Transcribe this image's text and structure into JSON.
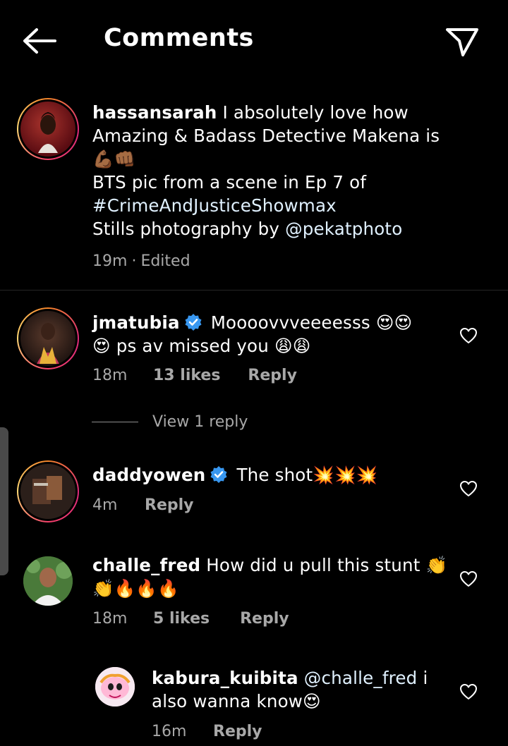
{
  "header": {
    "title": "Comments",
    "back_icon": "arrow-left-icon",
    "share_icon": "send-icon"
  },
  "caption": {
    "username": "hassansarah",
    "text_line1": "I absolutely love how",
    "text_line2": "Amazing & Badass Detective Makena is",
    "text_line3": "💪🏾👊🏾",
    "text_line4": "BTS pic from a scene in Ep 7 of",
    "hashtag": "#CrimeAndJusticeShowmax",
    "text_line6_prefix": "Stills photography by",
    "mention": "@pekatphoto",
    "time": "19m",
    "separator": "·",
    "edited": "Edited"
  },
  "comments": [
    {
      "username": "jmatubia",
      "verified": true,
      "text_line1": "Moooovvveeeesss 😍😍",
      "text_line2": "😍 ps av missed you 😩😩",
      "time": "18m",
      "likes": "13 likes",
      "reply": "Reply",
      "view_replies": "View 1 reply"
    },
    {
      "username": "daddyowen",
      "verified": true,
      "text_line1": "The shot💥💥💥",
      "time": "4m",
      "reply": "Reply"
    },
    {
      "username": "challe_fred",
      "verified": false,
      "text_line1": "How did u pull this stunt 👏",
      "text_line2": "👏🔥🔥🔥",
      "time": "18m",
      "likes": "5 likes",
      "reply": "Reply"
    },
    {
      "username": "kabura_kuibita",
      "mention": "@challe_fred",
      "text_line1_suffix": "i",
      "text_line2": "also wanna know😍",
      "time": "16m",
      "reply": "Reply"
    }
  ],
  "colors": {
    "background": "#000000",
    "meta": "#a8a8a8",
    "verified": "#3897f0",
    "divider": "#262626"
  }
}
